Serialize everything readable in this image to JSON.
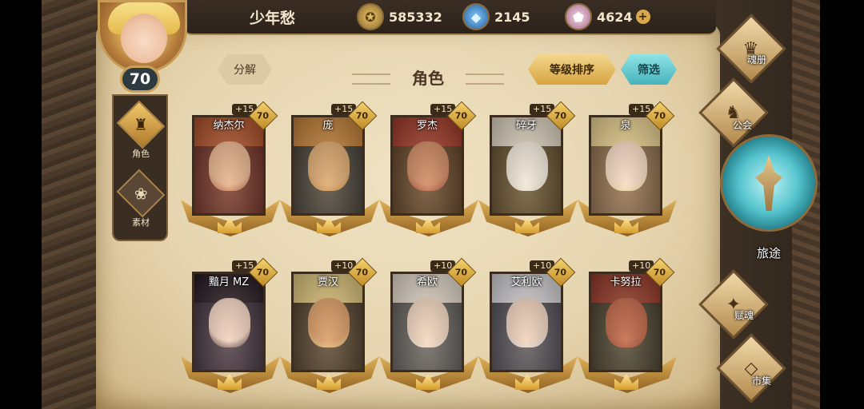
{
  "player": {
    "name": "少年愁",
    "level": "70"
  },
  "resources": {
    "gold": {
      "icon": "coin-icon",
      "value": "585332"
    },
    "gem": {
      "icon": "blue-crystal-icon",
      "value": "2145"
    },
    "crystal": {
      "icon": "pink-crystal-icon",
      "value": "4624"
    },
    "add_symbol": "+"
  },
  "side_tabs": [
    {
      "label": "角色",
      "icon": "helmet-icon",
      "active": true
    },
    {
      "label": "素材",
      "icon": "material-icon",
      "active": false
    }
  ],
  "header": {
    "decompose_label": "分解",
    "title": "角色",
    "sort_label": "等级排序",
    "filter_label": "筛选"
  },
  "cards": [
    {
      "name": "纳杰尔",
      "bonus": "+15",
      "level": "70",
      "hair": "#b4532c",
      "skin": "#e4b08a",
      "bg": "#6b2b22"
    },
    {
      "name": "庞",
      "bonus": "+15",
      "level": "70",
      "hair": "#c9853b",
      "skin": "#d9a468",
      "bg": "#3c3a32"
    },
    {
      "name": "罗杰",
      "bonus": "+15",
      "level": "70",
      "hair": "#a53a2a",
      "skin": "#c9805a",
      "bg": "#5a3d22"
    },
    {
      "name": "碎牙",
      "bonus": "+15",
      "level": "70",
      "hair": "#e8e0cf",
      "skin": "#f0ece2",
      "bg": "#5c4a2a"
    },
    {
      "name": "泉",
      "bonus": "+15",
      "level": "70",
      "hair": "#f4dc9a",
      "skin": "#f6dcc8",
      "bg": "#8a6a4a"
    },
    {
      "name": "黯月 MZ",
      "bonus": "+15",
      "level": "70",
      "hair": "#241a24",
      "skin": "#f2d3c4",
      "bg": "#3a2d3d"
    },
    {
      "name": "贾汉",
      "bonus": "+10",
      "level": "70",
      "hair": "#e6cf84",
      "skin": "#d6955e",
      "bg": "#4a3a28"
    },
    {
      "name": "希欧",
      "bonus": "+10",
      "level": "70",
      "hair": "#ece4d8",
      "skin": "#f2d8c4",
      "bg": "#5a5a5a"
    },
    {
      "name": "艾利欧",
      "bonus": "+10",
      "level": "70",
      "hair": "#dcdde4",
      "skin": "#f0d4c2",
      "bg": "#4a4a55"
    },
    {
      "name": "卡努拉",
      "bonus": "+10",
      "level": "70",
      "hair": "#9a3a2a",
      "skin": "#b8583a",
      "bg": "#3e3a2a"
    }
  ],
  "right_menu": {
    "soul_book": {
      "label": "魂册",
      "icon": "winged-helmet-icon"
    },
    "guild": {
      "label": "公会",
      "icon": "dragon-emblem-icon"
    },
    "journey": {
      "label": "旅途",
      "icon": "compass-emblem-icon"
    },
    "endow_soul": {
      "label": "赋魂",
      "icon": "flame-icon"
    },
    "market": {
      "label": "市集",
      "icon": "gem-icon"
    }
  }
}
